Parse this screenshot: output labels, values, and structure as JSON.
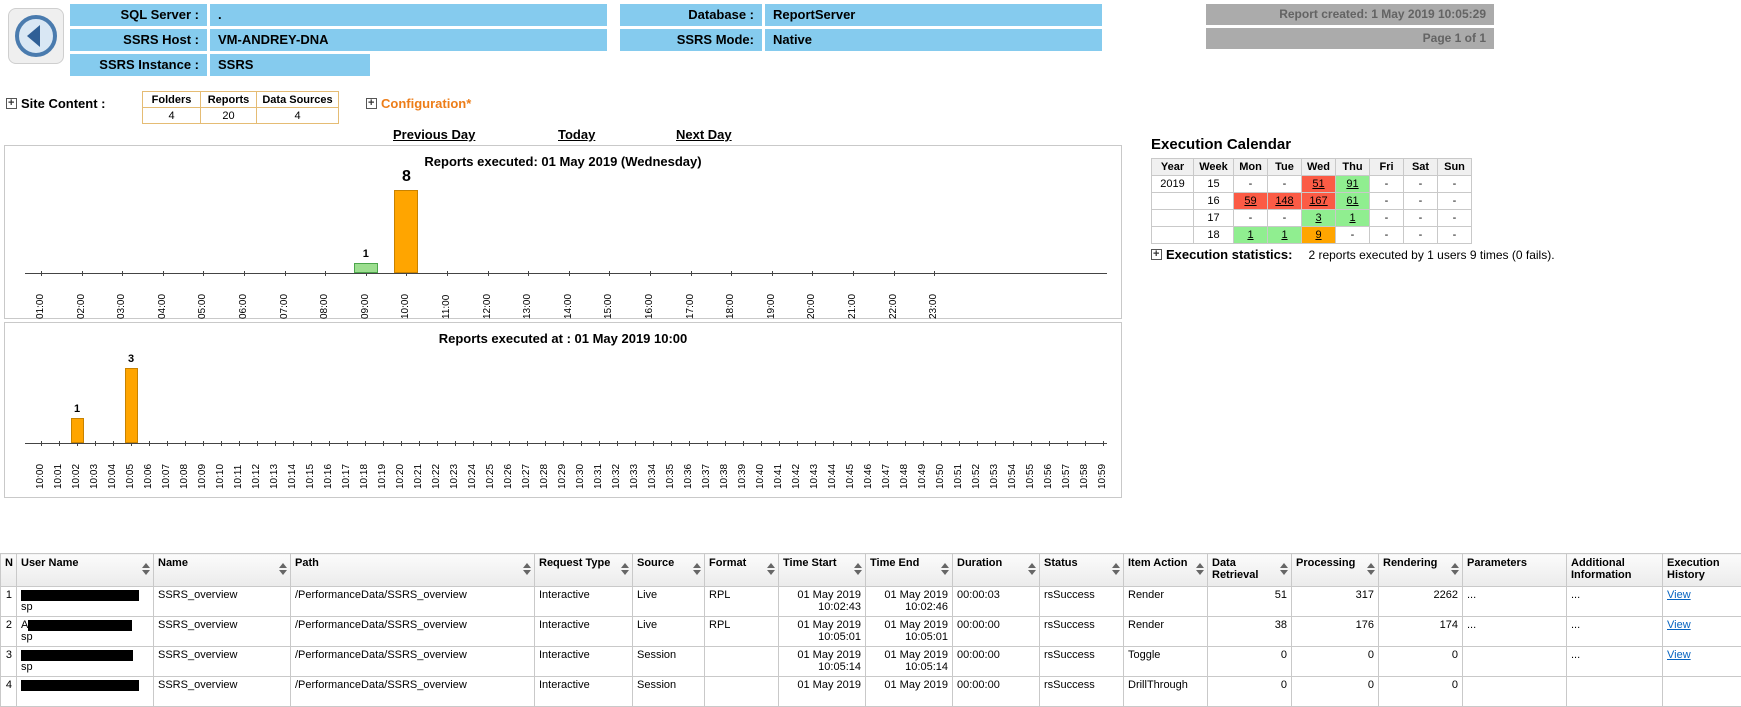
{
  "header": {
    "fields": [
      {
        "label": "SQL Server :",
        "value": "."
      },
      {
        "label": "SSRS Host :",
        "value": "VM-ANDREY-DNA"
      },
      {
        "label": "SSRS Instance :",
        "value": "SSRS"
      },
      {
        "label": "Database :",
        "value": "ReportServer"
      },
      {
        "label": "SSRS Mode:",
        "value": "Native"
      }
    ],
    "report_created": "Report created: 1 May 2019 10:05:29",
    "page_info": "Page 1 of 1"
  },
  "site_content": {
    "label": "Site Content :",
    "table": {
      "headers": [
        "Folders",
        "Reports",
        "Data Sources"
      ],
      "values": [
        "4",
        "20",
        "4"
      ]
    },
    "configuration_label": "Configuration*"
  },
  "nav": {
    "previous": "Previous Day",
    "today": "Today",
    "next": "Next Day"
  },
  "chart_data": [
    {
      "type": "bar",
      "title": "Reports executed:  01 May 2019 (Wednesday)",
      "xlabel": "",
      "ylabel": "",
      "ylim": [
        0,
        8
      ],
      "grid": false,
      "legend": "none",
      "categories": [
        "01:00",
        "02:00",
        "03:00",
        "04:00",
        "05:00",
        "06:00",
        "07:00",
        "08:00",
        "09:00",
        "10:00",
        "11:00",
        "12:00",
        "13:00",
        "14:00",
        "15:00",
        "16:00",
        "17:00",
        "18:00",
        "19:00",
        "20:00",
        "21:00",
        "22:00",
        "23:00"
      ],
      "values": [
        0,
        0,
        0,
        0,
        0,
        0,
        0,
        0,
        1,
        8,
        0,
        0,
        0,
        0,
        0,
        0,
        0,
        0,
        0,
        0,
        0,
        0,
        0
      ],
      "bar_styles": {
        "8": {
          "fill": "#9CDE8F",
          "stroke": "#4CA64C"
        },
        "9": {
          "fill": "#FFA500",
          "stroke": "#C88200"
        }
      },
      "max_label_large": true
    },
    {
      "type": "bar",
      "title": "Reports executed at : 01 May 2019 10:00",
      "xlabel": "",
      "ylabel": "",
      "ylim": [
        0,
        3
      ],
      "grid": false,
      "legend": "none",
      "categories": [
        "10:00",
        "10:01",
        "10:02",
        "10:03",
        "10:04",
        "10:05",
        "10:06",
        "10:07",
        "10:08",
        "10:09",
        "10:10",
        "10:11",
        "10:12",
        "10:13",
        "10:14",
        "10:15",
        "10:16",
        "10:17",
        "10:18",
        "10:19",
        "10:20",
        "10:21",
        "10:22",
        "10:23",
        "10:24",
        "10:25",
        "10:26",
        "10:27",
        "10:28",
        "10:29",
        "10:30",
        "10:31",
        "10:32",
        "10:33",
        "10:34",
        "10:35",
        "10:36",
        "10:37",
        "10:38",
        "10:39",
        "10:40",
        "10:41",
        "10:42",
        "10:43",
        "10:44",
        "10:45",
        "10:46",
        "10:47",
        "10:48",
        "10:49",
        "10:50",
        "10:51",
        "10:52",
        "10:53",
        "10:54",
        "10:55",
        "10:56",
        "10:57",
        "10:58",
        "10:59"
      ],
      "values": [
        0,
        0,
        1,
        0,
        0,
        3,
        0,
        0,
        0,
        0,
        0,
        0,
        0,
        0,
        0,
        0,
        0,
        0,
        0,
        0,
        0,
        0,
        0,
        0,
        0,
        0,
        0,
        0,
        0,
        0,
        0,
        0,
        0,
        0,
        0,
        0,
        0,
        0,
        0,
        0,
        0,
        0,
        0,
        0,
        0,
        0,
        0,
        0,
        0,
        0,
        0,
        0,
        0,
        0,
        0,
        0,
        0,
        0,
        0,
        0
      ],
      "bar_styles": {
        "2": {
          "fill": "#FFA500",
          "stroke": "#C88200"
        },
        "5": {
          "fill": "#FFA500",
          "stroke": "#C88200"
        }
      },
      "max_label_large": false
    }
  ],
  "calendar": {
    "title": "Execution Calendar",
    "headers": [
      "Year",
      "Week",
      "Mon",
      "Tue",
      "Wed",
      "Thu",
      "Fri",
      "Sat",
      "Sun"
    ],
    "cell_colors": {
      "red": "#FB5B45",
      "green": "#90EE90",
      "orange": "#FFA500"
    },
    "rows": [
      {
        "year": "2019",
        "week": "15",
        "days": [
          {
            "text": "-"
          },
          {
            "text": "-"
          },
          {
            "text": "51",
            "bg": "red",
            "link": true
          },
          {
            "text": "91",
            "bg": "green",
            "link": true
          },
          {
            "text": "-"
          },
          {
            "text": "-"
          },
          {
            "text": "-"
          }
        ]
      },
      {
        "year": "",
        "week": "16",
        "days": [
          {
            "text": "59",
            "bg": "red",
            "link": true
          },
          {
            "text": "148",
            "bg": "red",
            "link": true
          },
          {
            "text": "167",
            "bg": "red",
            "link": true
          },
          {
            "text": "61",
            "bg": "green",
            "link": true
          },
          {
            "text": "-"
          },
          {
            "text": "-"
          },
          {
            "text": "-"
          }
        ]
      },
      {
        "year": "",
        "week": "17",
        "days": [
          {
            "text": "-"
          },
          {
            "text": "-"
          },
          {
            "text": "3",
            "bg": "green",
            "link": true
          },
          {
            "text": "1",
            "bg": "green",
            "link": true
          },
          {
            "text": "-"
          },
          {
            "text": "-"
          },
          {
            "text": "-"
          }
        ]
      },
      {
        "year": "",
        "week": "18",
        "days": [
          {
            "text": "1",
            "bg": "green",
            "link": true
          },
          {
            "text": "1",
            "bg": "green",
            "link": true
          },
          {
            "text": "9",
            "bg": "orange",
            "link": true
          },
          {
            "text": "-"
          },
          {
            "text": "-"
          },
          {
            "text": "-"
          },
          {
            "text": "-"
          }
        ]
      }
    ]
  },
  "execution_statistics": {
    "label": "Execution statistics:",
    "text": "2 reports executed by 1 users 9 times (0 fails)."
  },
  "table": {
    "columns": [
      {
        "key": "n",
        "label": "N",
        "sortable": false
      },
      {
        "key": "user",
        "label": "User Name",
        "sortable": true
      },
      {
        "key": "name",
        "label": "Name",
        "sortable": true
      },
      {
        "key": "path",
        "label": "Path",
        "sortable": true
      },
      {
        "key": "request_type",
        "label": "Request Type",
        "sortable": true
      },
      {
        "key": "source",
        "label": "Source",
        "sortable": true
      },
      {
        "key": "format",
        "label": "Format",
        "sortable": true
      },
      {
        "key": "time_start",
        "label": "Time Start",
        "sortable": true
      },
      {
        "key": "time_end",
        "label": "Time End",
        "sortable": true
      },
      {
        "key": "duration",
        "label": "Duration",
        "sortable": true
      },
      {
        "key": "status",
        "label": "Status",
        "sortable": true
      },
      {
        "key": "item_action",
        "label": "Item Action",
        "sortable": true
      },
      {
        "key": "data_retrieval",
        "label": "Data Retrieval",
        "sortable": true
      },
      {
        "key": "processing",
        "label": "Processing",
        "sortable": true
      },
      {
        "key": "rendering",
        "label": "Rendering",
        "sortable": true
      },
      {
        "key": "parameters",
        "label": "Parameters",
        "sortable": false
      },
      {
        "key": "additional_information",
        "label": "Additional Information",
        "sortable": false
      },
      {
        "key": "execution_history",
        "label": "Execution History",
        "sortable": false
      }
    ],
    "rows": [
      {
        "n": "1",
        "user": {
          "prefix": "",
          "redact_width": 118,
          "line2": "sp"
        },
        "name": "SSRS_overview",
        "path": "/PerformanceData/SSRS_overview",
        "request_type": "Interactive",
        "source": "Live",
        "format": "RPL",
        "time_start": {
          "date": "01 May 2019",
          "time": "10:02:43"
        },
        "time_end": {
          "date": "01 May 2019",
          "time": "10:02:46"
        },
        "duration": "00:00:03",
        "status": "rsSuccess",
        "item_action": "Render",
        "data_retrieval": "51",
        "processing": "317",
        "rendering": "2262",
        "parameters": "...",
        "additional_information": "...",
        "execution_history": "View"
      },
      {
        "n": "2",
        "user": {
          "prefix": "A",
          "redact_width": 104,
          "line2": "sp"
        },
        "name": "SSRS_overview",
        "path": "/PerformanceData/SSRS_overview",
        "request_type": "Interactive",
        "source": "Live",
        "format": "RPL",
        "time_start": {
          "date": "01 May 2019",
          "time": "10:05:01"
        },
        "time_end": {
          "date": "01 May 2019",
          "time": "10:05:01"
        },
        "duration": "00:00:00",
        "status": "rsSuccess",
        "item_action": "Render",
        "data_retrieval": "38",
        "processing": "176",
        "rendering": "174",
        "parameters": "...",
        "additional_information": "...",
        "execution_history": "View"
      },
      {
        "n": "3",
        "user": {
          "prefix": "",
          "redact_width": 112,
          "line2": "sp"
        },
        "name": "SSRS_overview",
        "path": "/PerformanceData/SSRS_overview",
        "request_type": "Interactive",
        "source": "Session",
        "format": "",
        "time_start": {
          "date": "01 May 2019",
          "time": "10:05:14"
        },
        "time_end": {
          "date": "01 May 2019",
          "time": "10:05:14"
        },
        "duration": "00:00:00",
        "status": "rsSuccess",
        "item_action": "Toggle",
        "data_retrieval": "0",
        "processing": "0",
        "rendering": "0",
        "parameters": "",
        "additional_information": "...",
        "execution_history": "View"
      },
      {
        "n": "4",
        "user": {
          "prefix": "",
          "redact_width": 118,
          "line2": ""
        },
        "name": "SSRS_overview",
        "path": "/PerformanceData/SSRS_overview",
        "request_type": "Interactive",
        "source": "Session",
        "format": "",
        "time_start": {
          "date": "01 May 2019",
          "time": ""
        },
        "time_end": {
          "date": "01 May 2019",
          "time": ""
        },
        "duration": "00:00:00",
        "status": "rsSuccess",
        "item_action": "DrillThrough",
        "data_retrieval": "0",
        "processing": "0",
        "rendering": "0",
        "parameters": "",
        "additional_information": "",
        "execution_history": ""
      }
    ]
  },
  "colors": {
    "field_blue": "#85CBEE",
    "config_orange": "#ED7D18",
    "bar_orange": "#FFA500",
    "bar_green": "#9CDE8F",
    "link_blue": "#0563C1"
  }
}
